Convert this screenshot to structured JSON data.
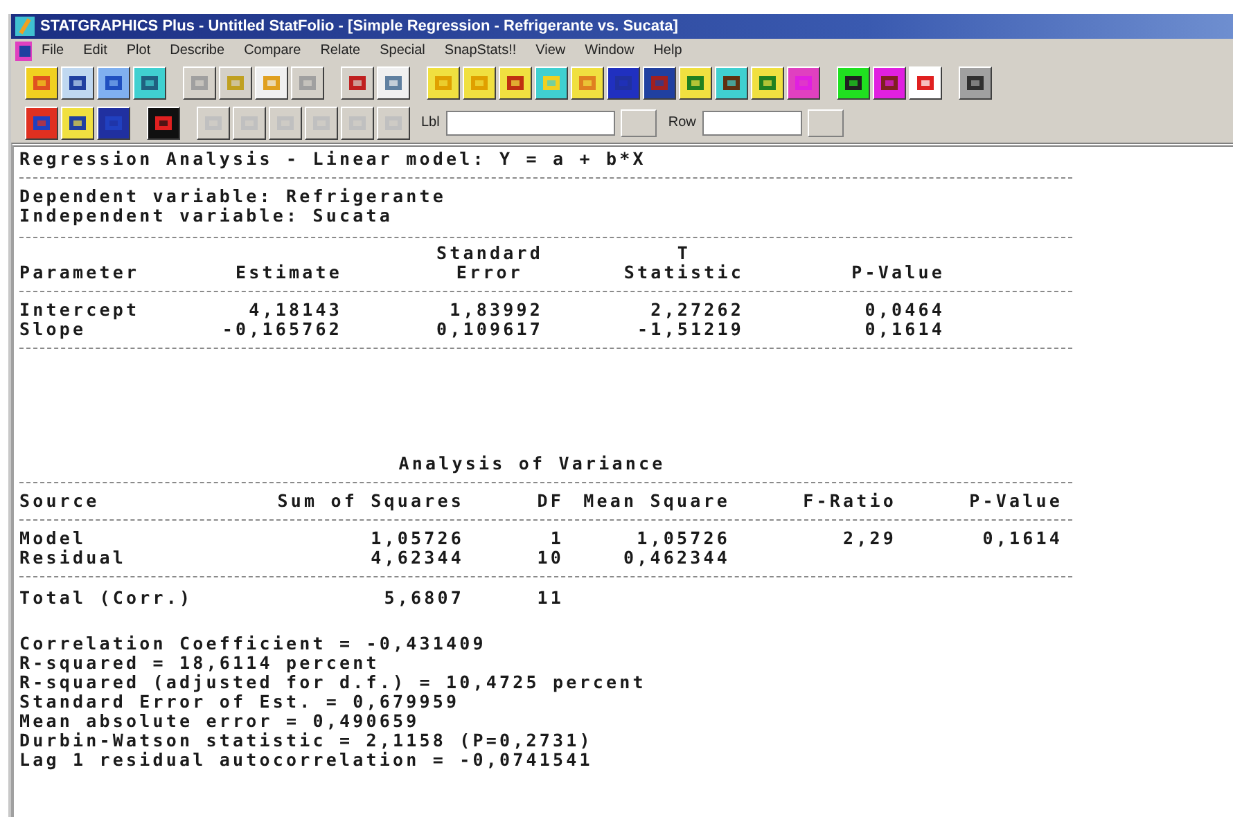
{
  "window": {
    "title": "STATGRAPHICS Plus - Untitled StatFolio - [Simple Regression - Refrigerante vs. Sucata]"
  },
  "menu": [
    "File",
    "Edit",
    "Plot",
    "Describe",
    "Compare",
    "Relate",
    "Special",
    "SnapStats!!",
    "View",
    "Window",
    "Help"
  ],
  "toolbar": {
    "label_field": {
      "label": "Lbl"
    },
    "row_field": {
      "label": "Row"
    }
  },
  "report": {
    "title": "Regression Analysis - Linear model: Y = a + b*X",
    "dependent": "Dependent variable: Refrigerante",
    "independent": "Independent variable: Sucata",
    "parameters": {
      "columns": [
        {
          "lines": [
            "Parameter"
          ]
        },
        {
          "lines": [
            "Estimate"
          ]
        },
        {
          "lines": [
            "Standard",
            "Error"
          ]
        },
        {
          "lines": [
            "T",
            "Statistic"
          ]
        },
        {
          "lines": [
            "P-Value"
          ]
        }
      ],
      "rows": [
        {
          "cells": [
            "Intercept",
            "4,18143",
            "1,83992",
            "2,27262",
            "0,0464"
          ]
        },
        {
          "cells": [
            "Slope",
            "-0,165762",
            "0,109617",
            "-1,51219",
            "0,1614"
          ]
        }
      ]
    },
    "anova": {
      "title": "Analysis of Variance",
      "columns": [
        "Source",
        "Sum of Squares",
        "DF",
        "Mean Square",
        "F-Ratio",
        "P-Value"
      ],
      "rows": [
        {
          "cells": [
            "Model",
            "1,05726",
            "1",
            "1,05726",
            "2,29",
            "0,1614"
          ]
        },
        {
          "cells": [
            "Residual",
            "4,62344",
            "10",
            "0,462344"
          ]
        }
      ],
      "total": [
        "Total (Corr.)",
        "5,6807",
        "11"
      ]
    },
    "statistics": [
      "Correlation Coefficient = -0,431409",
      "R-squared = 18,6114 percent",
      "R-squared (adjusted for d.f.) = 10,4725 percent",
      "Standard Error of Est. = 0,679959",
      "Mean absolute error = 0,490659",
      "Durbin-Watson statistic = 2,1158 (P=0,2731)",
      "Lag 1 residual autocorrelation = -0,0741541"
    ]
  }
}
